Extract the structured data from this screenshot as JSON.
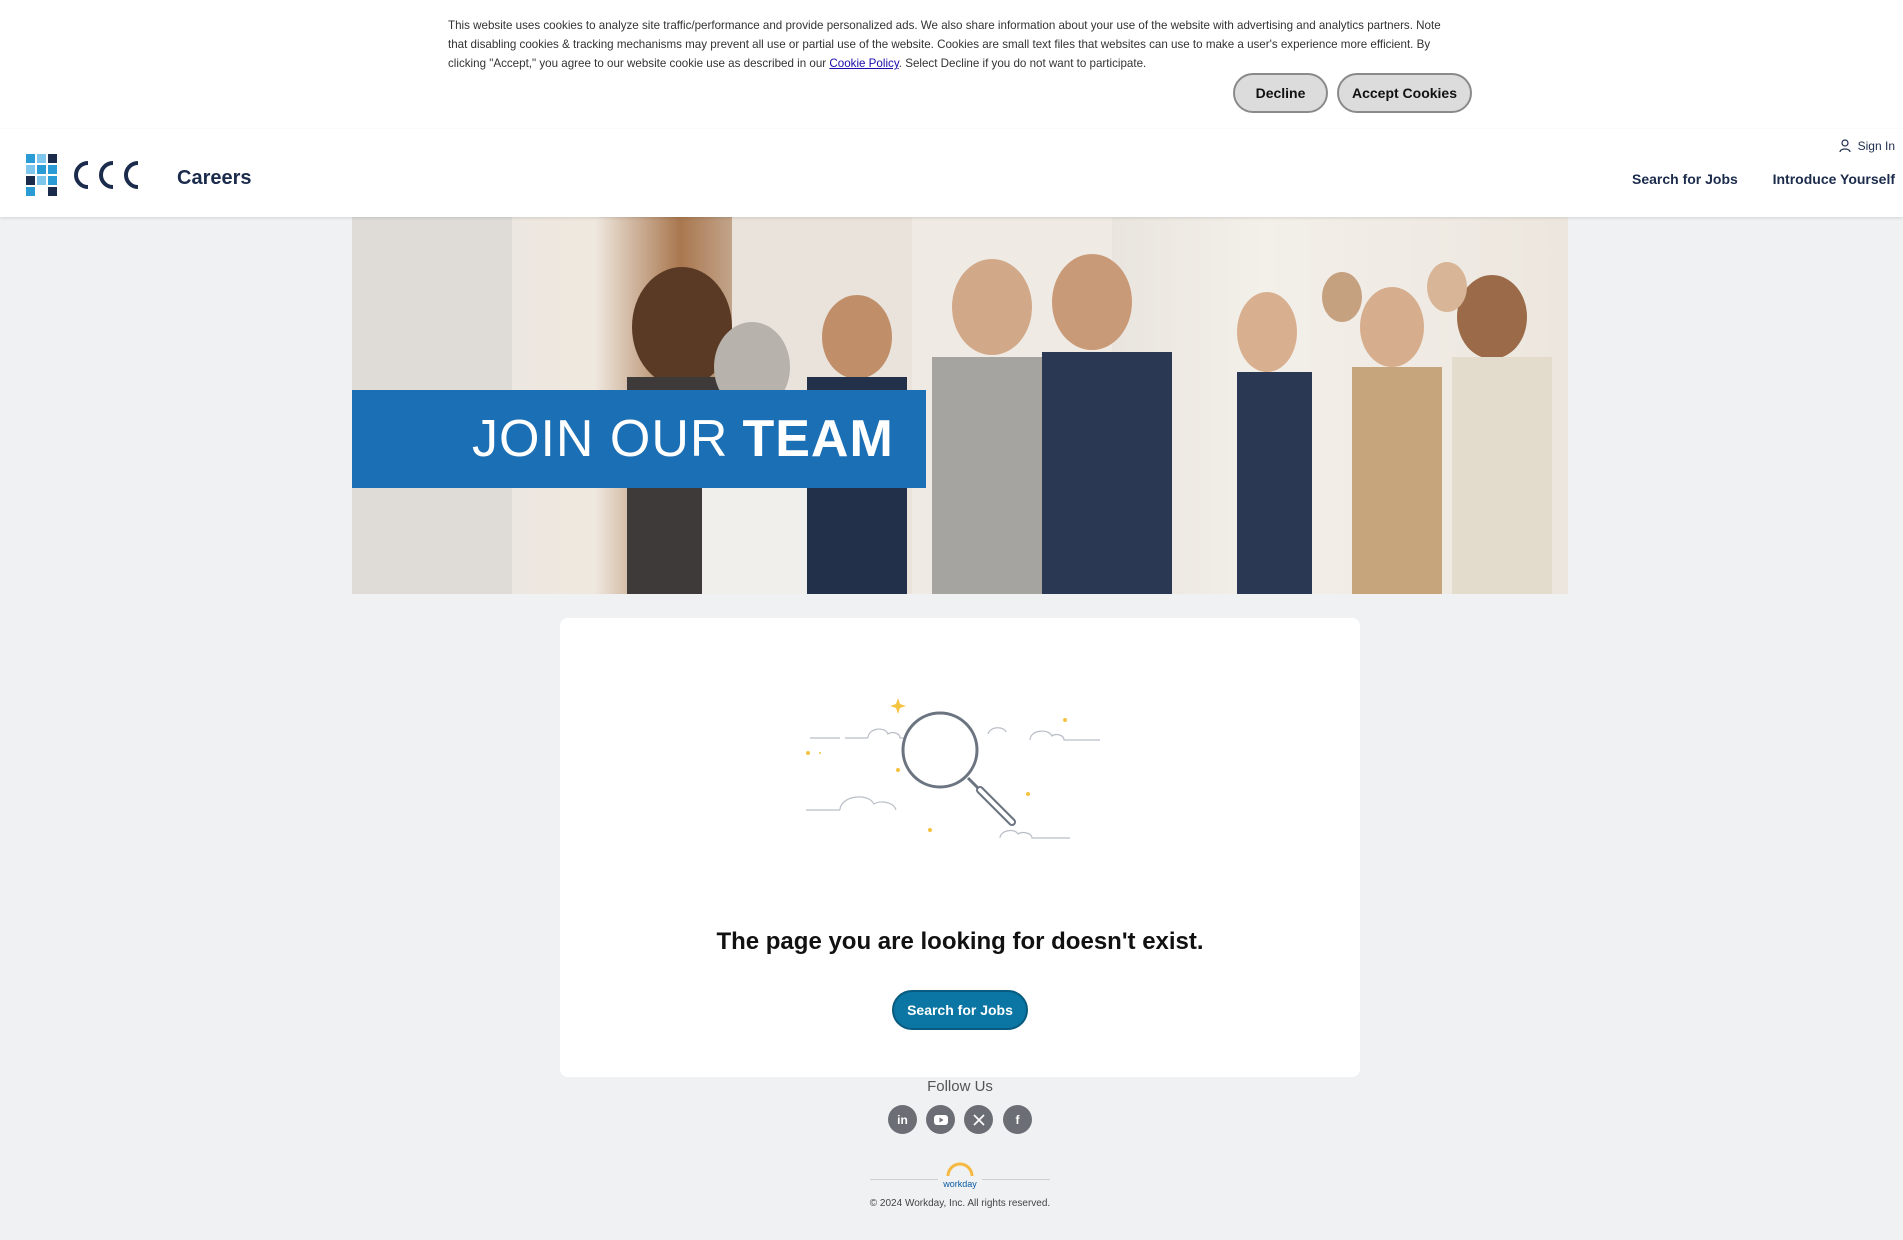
{
  "cookie_banner": {
    "text_before_link": "This website uses cookies to analyze site traffic/performance and provide personalized ads. We also share information about your use of the website with advertising and analytics partners. Note that disabling cookies & tracking mechanisms may prevent all use or partial use of the website. Cookies are small text files that websites can use to make a user's experience more efficient. By clicking \"Accept,\" you agree to our website cookie use as described in our ",
    "link_text": "Cookie Policy",
    "text_after_link": ". Select Decline if you do not want to participate.",
    "decline_label": "Decline",
    "accept_label": "Accept Cookies"
  },
  "header": {
    "logo_text": "CCC",
    "title": "Careers",
    "sign_in": "Sign In",
    "nav": [
      "Search for Jobs",
      "Introduce Yourself"
    ]
  },
  "hero": {
    "banner_light": "JOIN OUR",
    "banner_bold": "TEAM",
    "banner_color": "#1a6fb5"
  },
  "content": {
    "message": "The page you are looking for doesn't exist.",
    "button_label": "Search for Jobs",
    "button_color": "#0b76a3"
  },
  "footer": {
    "follow_title": "Follow Us",
    "social_icons": [
      "linkedin-icon",
      "youtube-icon",
      "x-icon",
      "facebook-icon"
    ],
    "workday_logo_text": "workday",
    "copyright": "© 2024 Workday, Inc. All rights reserved."
  }
}
